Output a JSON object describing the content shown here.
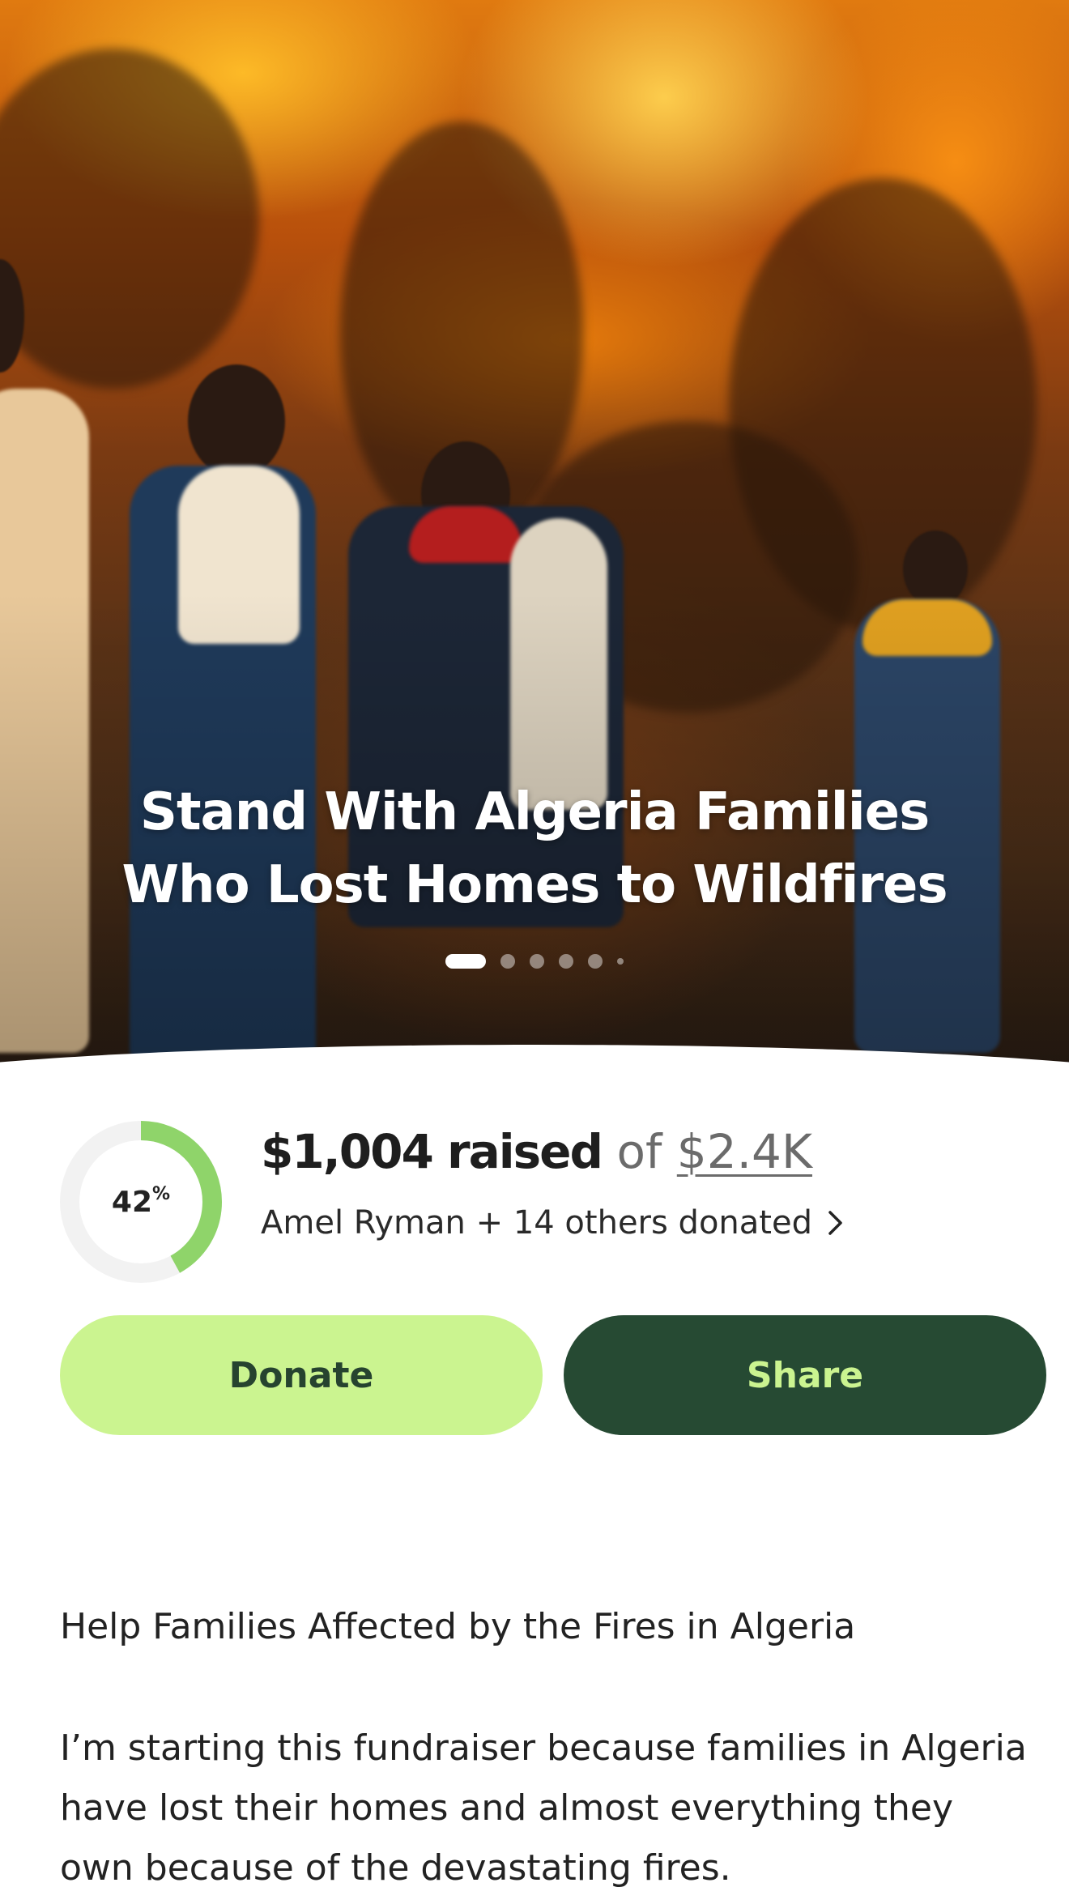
{
  "hero": {
    "title_line1": "Stand With Algeria Families",
    "title_line2": "Who Lost Homes to Wildfires",
    "image_alt": "wildfire scene with people walking",
    "carousel": {
      "count": 6,
      "active_index": 0
    }
  },
  "progress": {
    "percent": 42,
    "percent_number": "42",
    "percent_sign": "%",
    "ring_track_color": "#f2f2f2",
    "ring_fill_color": "#8fd46a"
  },
  "raised": {
    "amount": "$1,004 raised",
    "of": "of",
    "goal": "$2.4K"
  },
  "donors": {
    "text": "Amel Ryman + 14 others donated",
    "chevron_icon": "chevron-right-icon"
  },
  "actions": {
    "donate_label": "Donate",
    "share_label": "Share",
    "donate_bg": "#cbf490",
    "share_bg": "#264a33"
  },
  "story": {
    "title": "Help Families Affected by the Fires in Algeria",
    "body_line1": "I’m starting this fundraiser because families in Algeria",
    "body_line2": "have lost their homes and almost everything they",
    "body_line3": "own because of the devastating fires."
  }
}
